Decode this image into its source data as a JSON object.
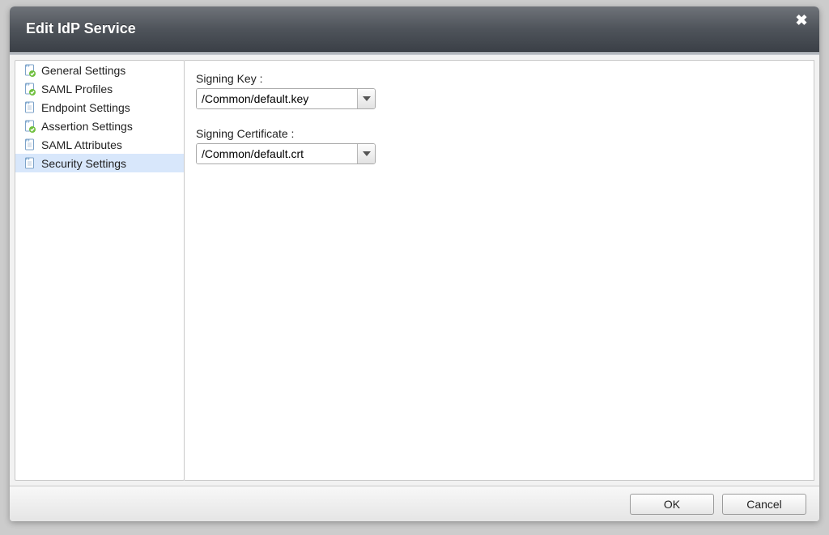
{
  "dialog": {
    "title": "Edit IdP Service"
  },
  "sidebar": {
    "items": [
      {
        "label": "General Settings",
        "done": true
      },
      {
        "label": "SAML Profiles",
        "done": true
      },
      {
        "label": "Endpoint Settings",
        "done": false
      },
      {
        "label": "Assertion Settings",
        "done": true
      },
      {
        "label": "SAML Attributes",
        "done": false
      },
      {
        "label": "Security Settings",
        "done": false,
        "selected": true
      }
    ]
  },
  "form": {
    "signing_key_label": "Signing Key",
    "signing_key_value": "/Common/default.key",
    "signing_cert_label": "Signing Certificate",
    "signing_cert_value": "/Common/default.crt"
  },
  "footer": {
    "ok": "OK",
    "cancel": "Cancel"
  }
}
